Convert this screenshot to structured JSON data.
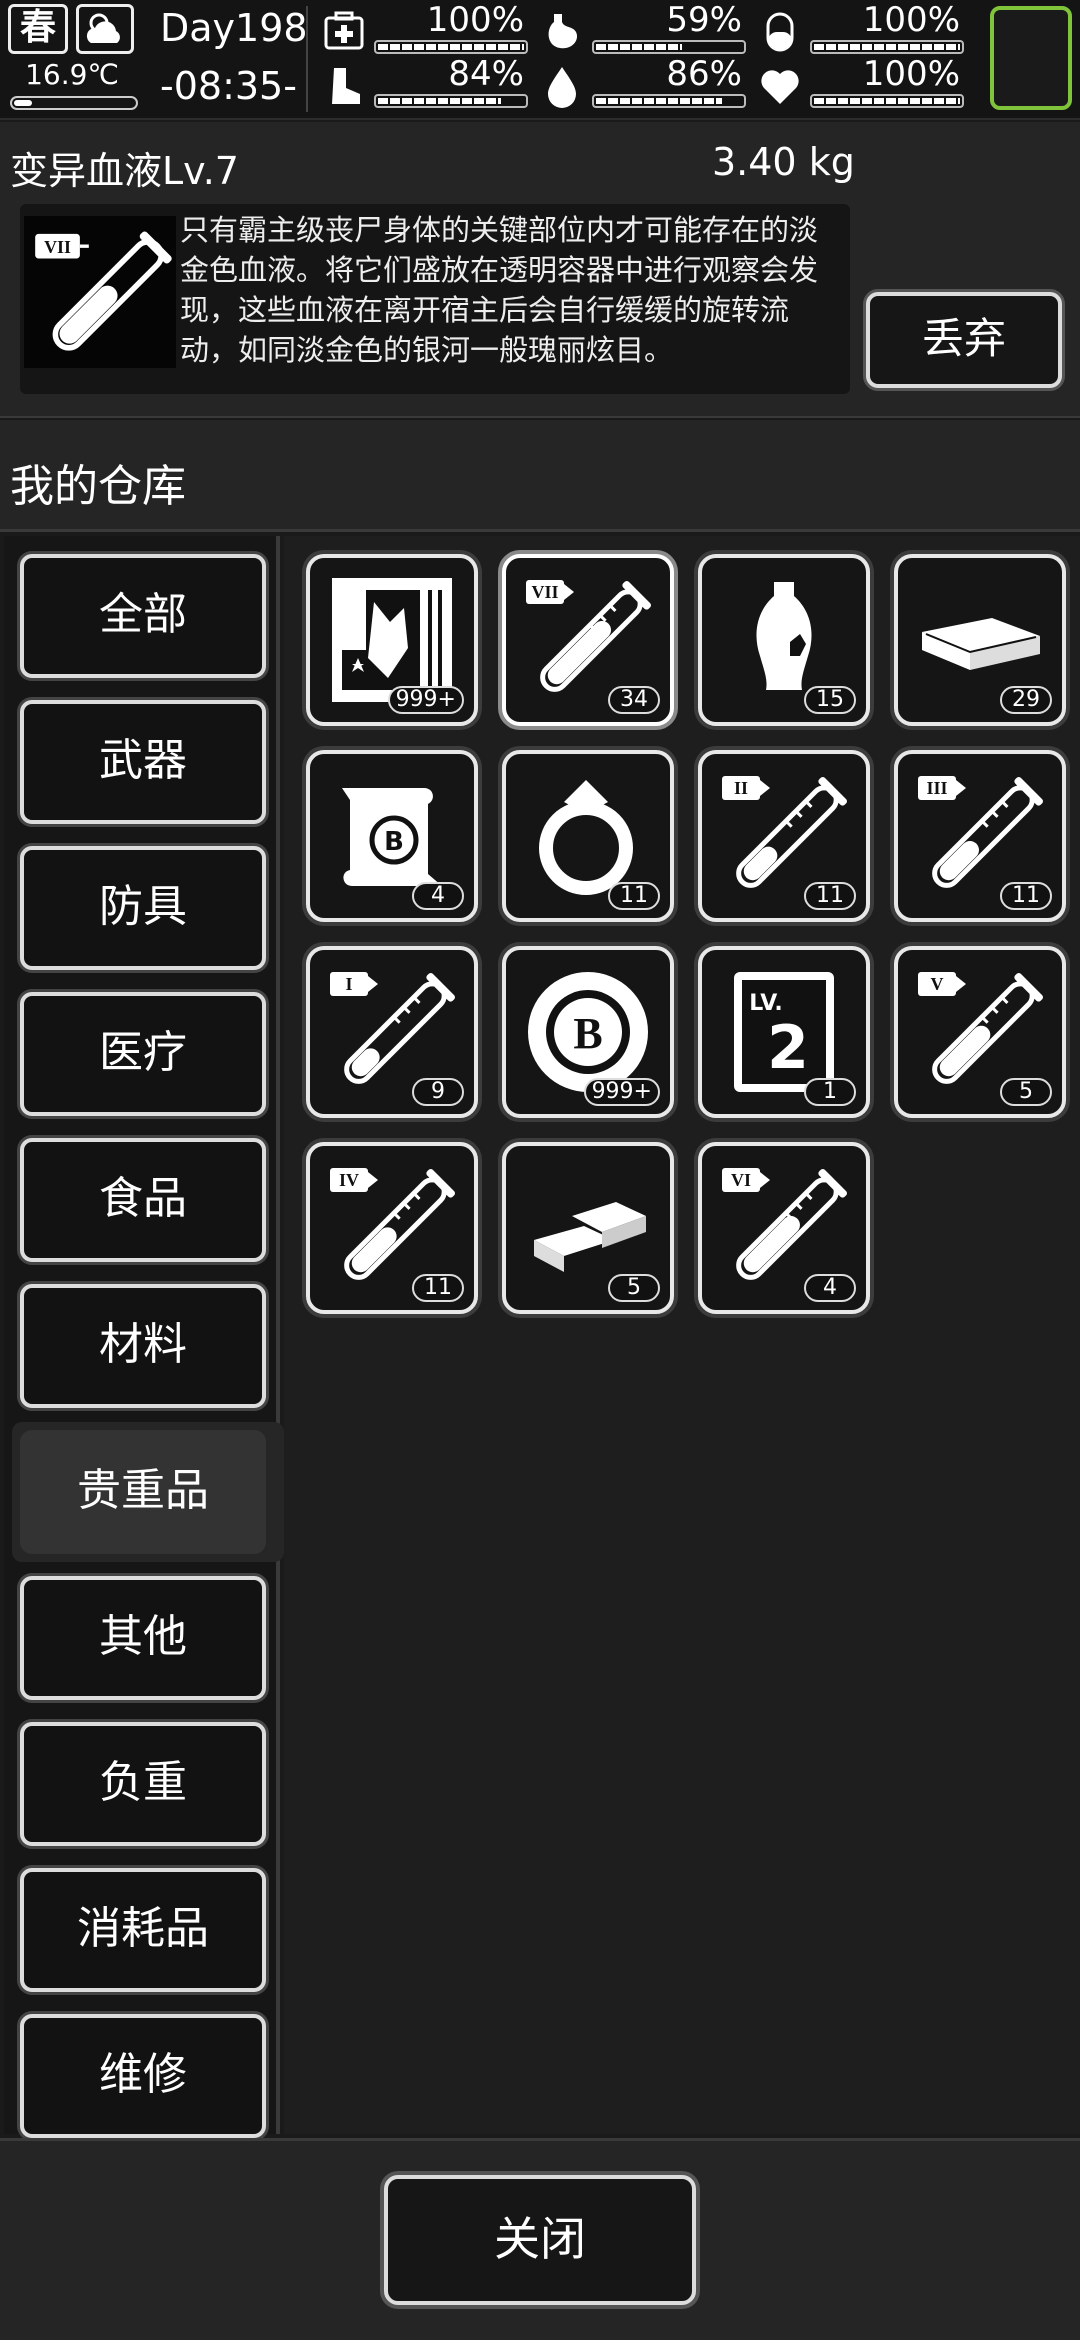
{
  "status": {
    "season": "春",
    "temperature": "16.9℃",
    "temperature_level": 0.15,
    "day": "Day198",
    "time": "-08:35-",
    "stats": [
      {
        "name": "health-icon",
        "percent": "100%",
        "level": 1.0
      },
      {
        "name": "stomach-icon",
        "percent": "59%",
        "level": 0.59
      },
      {
        "name": "pill-icon",
        "percent": "100%",
        "level": 1.0
      },
      {
        "name": "foot-icon",
        "percent": "84%",
        "level": 0.84
      },
      {
        "name": "water-drop-icon",
        "percent": "86%",
        "level": 0.86
      },
      {
        "name": "heart-icon",
        "percent": "100%",
        "level": 1.0
      }
    ]
  },
  "detail": {
    "name": "变异血液Lv.7",
    "weight": "3.40 kg",
    "description": "只有霸主级丧尸身体的关键部位内才可能存在的淡金色血液。将它们盛放在透明容器中进行观察会发现，这些血液在离开宿主后会自行缓缓的旋转流动，如同淡金色的银河一般瑰丽炫目。",
    "discard_label": "丢弃"
  },
  "warehouse_title": "我的仓库",
  "categories": [
    {
      "label": "全部"
    },
    {
      "label": "武器"
    },
    {
      "label": "防具"
    },
    {
      "label": "医疗"
    },
    {
      "label": "食品"
    },
    {
      "label": "材料"
    },
    {
      "label": "贵重品",
      "active": true
    },
    {
      "label": "其他"
    },
    {
      "label": "负重"
    },
    {
      "label": "消耗品"
    },
    {
      "label": "维修"
    }
  ],
  "items": [
    {
      "icon": "poster-icon",
      "qty": "999+"
    },
    {
      "icon": "blood-vial-7-icon",
      "qty": "34",
      "selected": true
    },
    {
      "icon": "vase-icon",
      "qty": "15"
    },
    {
      "icon": "cash-bundle-icon",
      "qty": "29"
    },
    {
      "icon": "scroll-icon",
      "qty": "4"
    },
    {
      "icon": "ring-icon",
      "qty": "11"
    },
    {
      "icon": "blood-vial-2-icon",
      "qty": "11"
    },
    {
      "icon": "blood-vial-3-icon",
      "qty": "11"
    },
    {
      "icon": "blood-vial-1-icon",
      "qty": "9"
    },
    {
      "icon": "coin-icon",
      "qty": "999+"
    },
    {
      "icon": "level-card-icon",
      "qty": "1"
    },
    {
      "icon": "blood-vial-5-icon",
      "qty": "5"
    },
    {
      "icon": "blood-vial-4-icon",
      "qty": "11"
    },
    {
      "icon": "gold-bars-icon",
      "qty": "5"
    },
    {
      "icon": "blood-vial-6-icon",
      "qty": "4"
    }
  ],
  "close_label": "关闭"
}
